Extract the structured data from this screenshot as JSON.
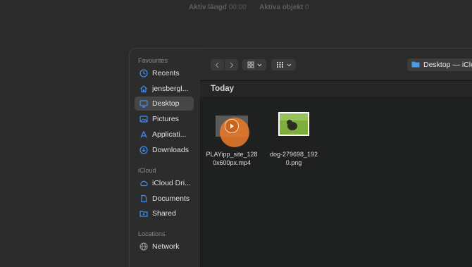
{
  "topbar": {
    "duration_label": "Aktiv längd",
    "duration_value": "00:00",
    "objects_label": "Aktiva objekt",
    "objects_value": "0"
  },
  "sidebar": {
    "favourites_header": "Favourites",
    "favourites": [
      {
        "label": "Recents",
        "icon": "clock-icon"
      },
      {
        "label": "jensbergl...",
        "icon": "home-icon"
      },
      {
        "label": "Desktop",
        "icon": "desktop-icon",
        "active": true
      },
      {
        "label": "Pictures",
        "icon": "pictures-icon"
      },
      {
        "label": "Applicati...",
        "icon": "applications-icon"
      },
      {
        "label": "Downloads",
        "icon": "download-icon"
      }
    ],
    "icloud_header": "iCloud",
    "icloud": [
      {
        "label": "iCloud Dri...",
        "icon": "cloud-icon"
      },
      {
        "label": "Documents",
        "icon": "document-icon"
      },
      {
        "label": "Shared",
        "icon": "shared-folder-icon"
      }
    ],
    "locations_header": "Locations",
    "locations": [
      {
        "label": "Network",
        "icon": "globe-icon"
      }
    ]
  },
  "toolbar": {
    "location": "Desktop — iCloud"
  },
  "content": {
    "section_title": "Today",
    "files": [
      {
        "name_line1": "PLAYipp_site_128",
        "name_line2": "0x600px.mp4",
        "icon": "video-thumbnail-icon"
      },
      {
        "name_line1": "dog-279698_192",
        "name_line2": "0.png",
        "icon": "image-thumbnail-icon"
      }
    ]
  },
  "colors": {
    "accent": "#2f6fd5",
    "sidebar_icon": "#3d8ff2",
    "play_orange": "#e8792a"
  }
}
